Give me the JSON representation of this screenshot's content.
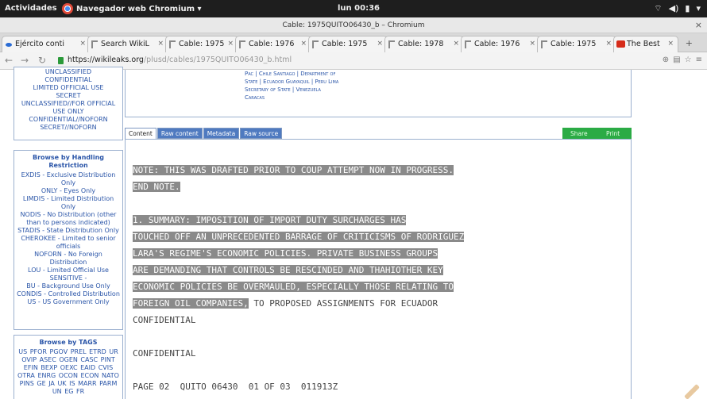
{
  "system_bar": {
    "activities": "Actividades",
    "app_name": "Navegador web Chromium ▾",
    "clock": "lun 00:36",
    "tray_icons": [
      "network-icon",
      "volume-icon",
      "battery-icon",
      "menu-arrow-icon"
    ]
  },
  "window": {
    "title": "Cable: 1975QUITO06430_b – Chromium"
  },
  "tabs": [
    {
      "label": "Ejército conti",
      "icon": "globe-icon"
    },
    {
      "label": "Search WikiL",
      "icon": "wikileaks-icon"
    },
    {
      "label": "Cable: 1975",
      "icon": "wikileaks-icon"
    },
    {
      "label": "Cable: 1976",
      "icon": "wikileaks-icon"
    },
    {
      "label": "Cable: 1975",
      "icon": "wikileaks-icon"
    },
    {
      "label": "Cable: 1978",
      "icon": "wikileaks-icon"
    },
    {
      "label": "Cable: 1976",
      "icon": "wikileaks-icon"
    },
    {
      "label": "Cable: 1975",
      "icon": "wikileaks-icon"
    },
    {
      "label": "The Best",
      "icon": "youtube-icon"
    }
  ],
  "address": {
    "scheme_host": "https://wikileaks.org",
    "path": "/plusd/cables/1975QUITO06430_b.html"
  },
  "classification": {
    "items": [
      "UNCLASSIFIED",
      "CONFIDENTIAL",
      "LIMITED OFFICIAL USE",
      "SECRET",
      "UNCLASSIFIED//FOR OFFICIAL USE ONLY",
      "CONFIDENTIAL//NOFORN",
      "SECRET//NOFORN"
    ]
  },
  "handling": {
    "heading": "Browse by Handling Restriction",
    "items": [
      "EXDIS - Exclusive Distribution Only",
      "ONLY - Eyes Only",
      "LIMDIS - Limited Distribution Only",
      "NODIS - No Distribution (other than to persons indicated)",
      "STADIS - State Distribution Only",
      "CHEROKEE - Limited to senior officials",
      "NOFORN - No Foreign Distribution",
      "LOU - Limited Official Use",
      "SENSITIVE -",
      "BU - Background Use Only",
      "CONDIS - Controlled Distribution",
      "US - US Government Only"
    ]
  },
  "tags": {
    "heading": "Browse by TAGS",
    "text": "US PFOR PGOV PREL ETRD UR OVIP ASEC OGEN CASC PINT EFIN BEXP OEXC EAID CVIS OTRA ENRG OCON ECON NATO PINS GE JA UK IS MARR PARM UN EG FR"
  },
  "top_links": {
    "line1": "Pac | Chile Santiago | Department of",
    "line2": "State | Ecuador Guayaquil | Peru Lima",
    "line3": "Secretary of State | Venezuela",
    "line4": "Caracas"
  },
  "content_tabs": [
    "Content",
    "Raw content",
    "Metadata",
    "Raw source"
  ],
  "actions": {
    "share": "Share",
    "print": "Print"
  },
  "cable": {
    "lines": [
      {
        "text": "NOTE: THIS WAS DRAFTED PRIOR TO COUP ATTEMPT NOW IN PROGRESS.",
        "highlight": true
      },
      {
        "text": "END NOTE.",
        "highlight": true
      },
      {
        "text": "",
        "highlight": false
      },
      {
        "text": "1. SUMMARY: IMPOSITION OF IMPORT DUTY SURCHARGES HAS",
        "highlight": true
      },
      {
        "text": "TOUCHED OFF AN UNPRECEDENTED BARRAGE OF CRITICISMS OF RODRIGUEZ",
        "highlight": true
      },
      {
        "text": "LARA'S REGIME'S ECONOMIC POLICIES. PRIVATE BUSINESS GROUPS",
        "highlight": true
      },
      {
        "text": "ARE DEMANDING THAT CONTROLS BE RESCINDED AND THAHIOTHER KEY",
        "highlight": true
      },
      {
        "text": "ECONOMIC POLICIES BE OVERMAULED, ESPECIALLY THOSE RELATING TO",
        "highlight": true
      },
      {
        "text_hl": "FOREIGN OIL COMPANIES,",
        "text_rest": " TO PROPOSED ASSIGNMENTS FOR ECUADOR",
        "split": true
      },
      {
        "text": "CONFIDENTIAL",
        "highlight": false
      },
      {
        "text": "",
        "highlight": false
      },
      {
        "text": "CONFIDENTIAL",
        "highlight": false
      },
      {
        "text": "",
        "highlight": false
      },
      {
        "text": "PAGE 02  QUITO 06430  01 OF 03  011913Z",
        "highlight": false
      }
    ]
  },
  "colors": {
    "link_blue": "#2a55a8",
    "highlight_gray": "#8a8a8a",
    "share_green": "#2bab45",
    "tab_blue": "#4f7ac0"
  }
}
